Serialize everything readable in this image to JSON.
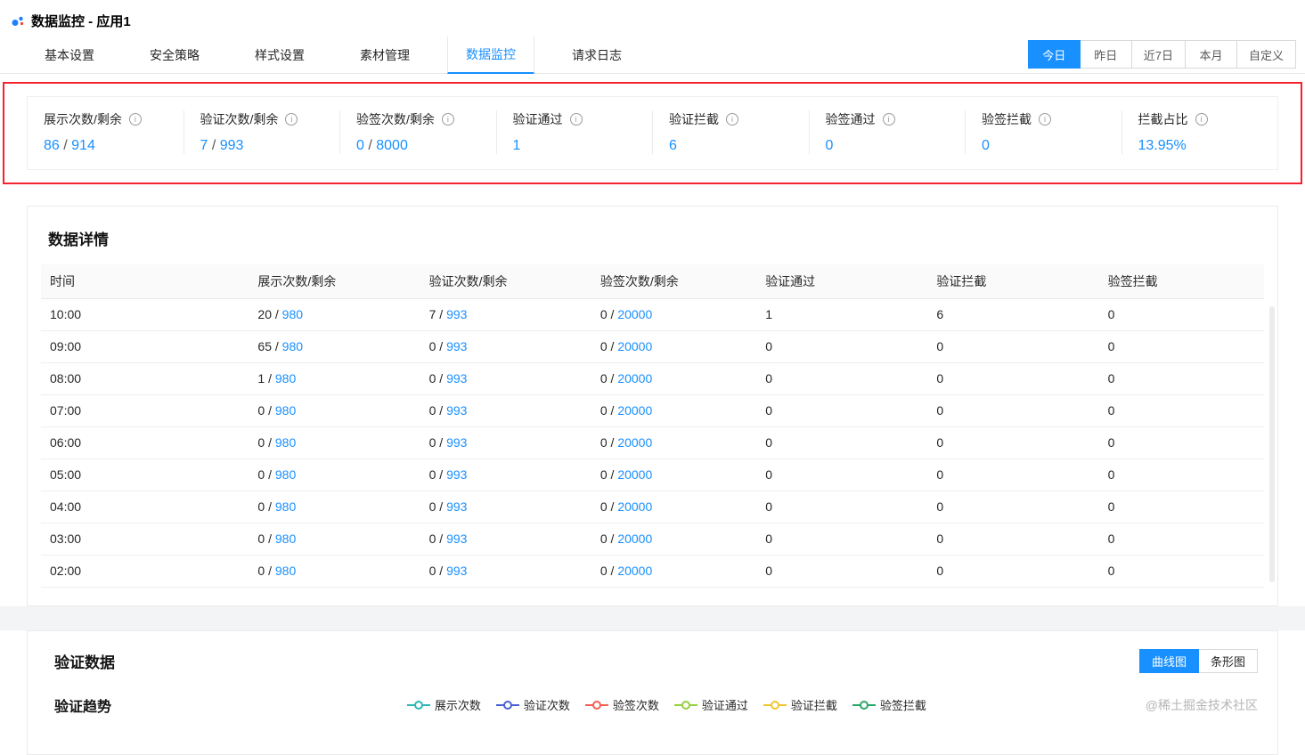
{
  "header": {
    "title": "数据监控 - 应用1"
  },
  "tabs": {
    "items": [
      {
        "id": "basic-settings",
        "label": "基本设置",
        "active": false
      },
      {
        "id": "security-policy",
        "label": "安全策略",
        "active": false
      },
      {
        "id": "style-settings",
        "label": "样式设置",
        "active": false
      },
      {
        "id": "material-management",
        "label": "素材管理",
        "active": false
      },
      {
        "id": "data-monitoring",
        "label": "数据监控",
        "active": true
      },
      {
        "id": "request-logs",
        "label": "请求日志",
        "active": false
      }
    ]
  },
  "date_filters": {
    "items": [
      {
        "id": "today",
        "label": "今日",
        "active": true
      },
      {
        "id": "yesterday",
        "label": "昨日",
        "active": false
      },
      {
        "id": "last-7-days",
        "label": "近7日",
        "active": false
      },
      {
        "id": "this-month",
        "label": "本月",
        "active": false
      },
      {
        "id": "custom",
        "label": "自定义",
        "active": false
      }
    ]
  },
  "stats": {
    "items": [
      {
        "id": "impressions-remaining",
        "label": "展示次数/剩余",
        "main": "86",
        "remain": "914"
      },
      {
        "id": "verify-count-remaining",
        "label": "验证次数/剩余",
        "main": "7",
        "remain": "993"
      },
      {
        "id": "sign-count-remaining",
        "label": "验签次数/剩余",
        "main": "0",
        "remain": "8000"
      },
      {
        "id": "verify-pass",
        "label": "验证通过",
        "main": "1",
        "remain": null
      },
      {
        "id": "verify-block",
        "label": "验证拦截",
        "main": "6",
        "remain": null
      },
      {
        "id": "sign-pass",
        "label": "验签通过",
        "main": "0",
        "remain": null
      },
      {
        "id": "sign-block",
        "label": "验签拦截",
        "main": "0",
        "remain": null
      },
      {
        "id": "block-ratio",
        "label": "拦截占比",
        "main": "13.95%",
        "remain": null
      }
    ]
  },
  "detail_table": {
    "title": "数据详情",
    "columns": [
      "时间",
      "展示次数/剩余",
      "验证次数/剩余",
      "验签次数/剩余",
      "验证通过",
      "验证拦截",
      "验签拦截"
    ],
    "rows": [
      {
        "time": "10:00",
        "impressions": "20",
        "impressions_remain": "980",
        "verify": "7",
        "verify_remain": "993",
        "sign": "0",
        "sign_remain": "20000",
        "verify_pass": "1",
        "verify_block": "6",
        "sign_block": "0"
      },
      {
        "time": "09:00",
        "impressions": "65",
        "impressions_remain": "980",
        "verify": "0",
        "verify_remain": "993",
        "sign": "0",
        "sign_remain": "20000",
        "verify_pass": "0",
        "verify_block": "0",
        "sign_block": "0"
      },
      {
        "time": "08:00",
        "impressions": "1",
        "impressions_remain": "980",
        "verify": "0",
        "verify_remain": "993",
        "sign": "0",
        "sign_remain": "20000",
        "verify_pass": "0",
        "verify_block": "0",
        "sign_block": "0"
      },
      {
        "time": "07:00",
        "impressions": "0",
        "impressions_remain": "980",
        "verify": "0",
        "verify_remain": "993",
        "sign": "0",
        "sign_remain": "20000",
        "verify_pass": "0",
        "verify_block": "0",
        "sign_block": "0"
      },
      {
        "time": "06:00",
        "impressions": "0",
        "impressions_remain": "980",
        "verify": "0",
        "verify_remain": "993",
        "sign": "0",
        "sign_remain": "20000",
        "verify_pass": "0",
        "verify_block": "0",
        "sign_block": "0"
      },
      {
        "time": "05:00",
        "impressions": "0",
        "impressions_remain": "980",
        "verify": "0",
        "verify_remain": "993",
        "sign": "0",
        "sign_remain": "20000",
        "verify_pass": "0",
        "verify_block": "0",
        "sign_block": "0"
      },
      {
        "time": "04:00",
        "impressions": "0",
        "impressions_remain": "980",
        "verify": "0",
        "verify_remain": "993",
        "sign": "0",
        "sign_remain": "20000",
        "verify_pass": "0",
        "verify_block": "0",
        "sign_block": "0"
      },
      {
        "time": "03:00",
        "impressions": "0",
        "impressions_remain": "980",
        "verify": "0",
        "verify_remain": "993",
        "sign": "0",
        "sign_remain": "20000",
        "verify_pass": "0",
        "verify_block": "0",
        "sign_block": "0"
      },
      {
        "time": "02:00",
        "impressions": "0",
        "impressions_remain": "980",
        "verify": "0",
        "verify_remain": "993",
        "sign": "0",
        "sign_remain": "20000",
        "verify_pass": "0",
        "verify_block": "0",
        "sign_block": "0"
      }
    ]
  },
  "verify_section": {
    "title": "验证数据",
    "chart_type_buttons": [
      {
        "id": "line-chart",
        "label": "曲线图",
        "active": true
      },
      {
        "id": "bar-chart",
        "label": "条形图",
        "active": false
      }
    ],
    "trend_title": "验证趋势",
    "legend": [
      {
        "id": "impressions",
        "label": "展示次数",
        "color": "#2db7b5"
      },
      {
        "id": "verify-count",
        "label": "验证次数",
        "color": "#4961d2"
      },
      {
        "id": "sign-count",
        "label": "验签次数",
        "color": "#f65e52"
      },
      {
        "id": "verify-pass",
        "label": "验证通过",
        "color": "#97cf3f"
      },
      {
        "id": "verify-block",
        "label": "验证拦截",
        "color": "#f2c52f"
      },
      {
        "id": "sign-block",
        "label": "验签拦截",
        "color": "#2aa76b"
      }
    ]
  },
  "watermark": "@稀土掘金技术社区",
  "colors": {
    "accent": "#1890ff",
    "annotation": "#f5222d"
  }
}
